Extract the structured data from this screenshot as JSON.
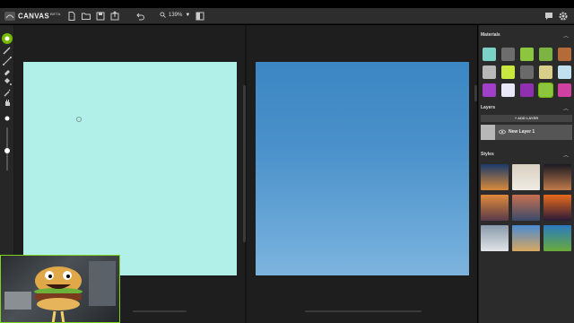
{
  "app": {
    "name": "CANVAS",
    "badge": "BETA"
  },
  "toolbar_top": {
    "zoom_value": "139%",
    "zoom_caret": "▼"
  },
  "materials": {
    "title": "Materials",
    "swatches": [
      "#7bd3c8",
      "#6d6d6d",
      "#8cc63f",
      "#7cb342",
      "#b56a3a",
      "#b8b8b8",
      "#c8e840",
      "#6a6a6a",
      "#d8d08a",
      "#c0e0f0",
      "#a040c8",
      "#e8e8f8",
      "#9030b0",
      "#8cc63f",
      "#d040a0"
    ]
  },
  "layers": {
    "title": "Layers",
    "add_label": "+ ADD LAYER",
    "items": [
      {
        "name": "New Layer 1"
      }
    ]
  },
  "styles": {
    "title": "Styles"
  },
  "colors": {
    "accent": "#76b900",
    "left_canvas": "#b0f0e8"
  }
}
